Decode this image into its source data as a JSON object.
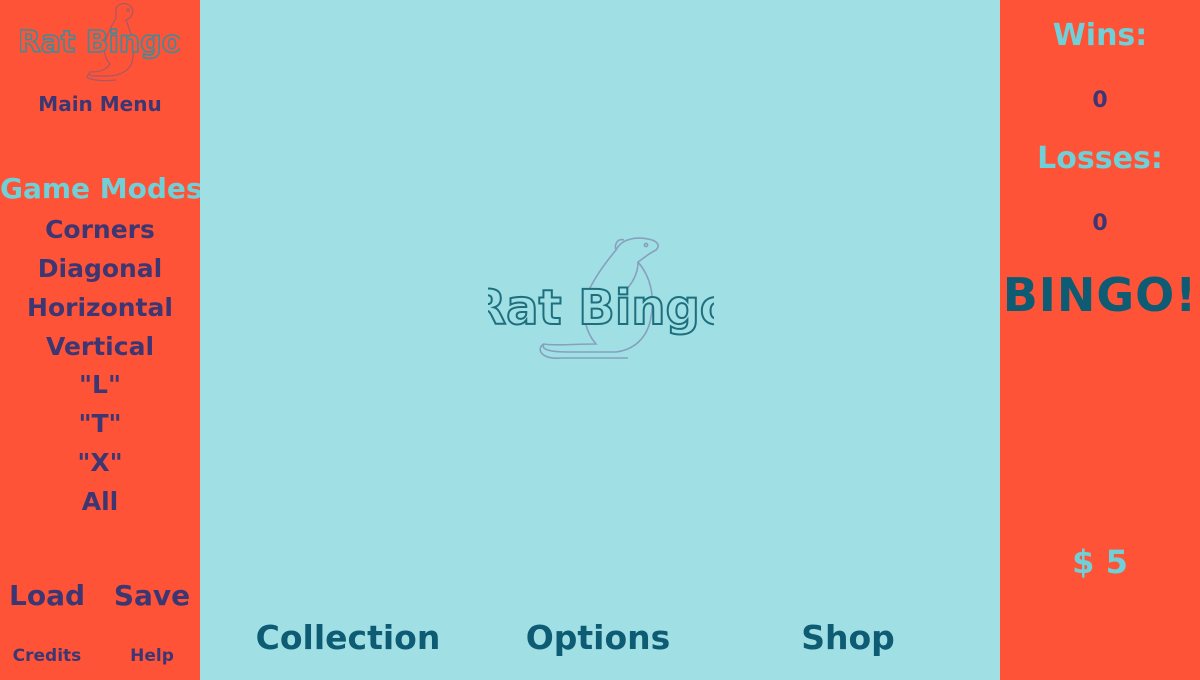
{
  "title": "Rat Bingo",
  "colors": {
    "panel": "#ff5338",
    "board": "#a0dfe4",
    "navy_text": "#3c3772",
    "teal_text": "#0e5b74",
    "light_text": "#6fd0d7"
  },
  "left_panel": {
    "main_menu_label": "Main Menu",
    "game_modes_title": "Game Modes",
    "game_modes": [
      "Corners",
      "Diagonal",
      "Horizontal",
      "Vertical",
      "\"L\"",
      "\"T\"",
      "\"X\"",
      "All"
    ],
    "load_label": "Load",
    "save_label": "Save",
    "credits_label": "Credits",
    "help_label": "Help"
  },
  "bottom_nav": {
    "collection_label": "Collection",
    "options_label": "Options",
    "shop_label": "Shop"
  },
  "right_panel": {
    "wins_label": "Wins:",
    "wins_value": "0",
    "losses_label": "Losses:",
    "losses_value": "0",
    "bingo_label": "BINGO!",
    "money": "$ 5"
  }
}
